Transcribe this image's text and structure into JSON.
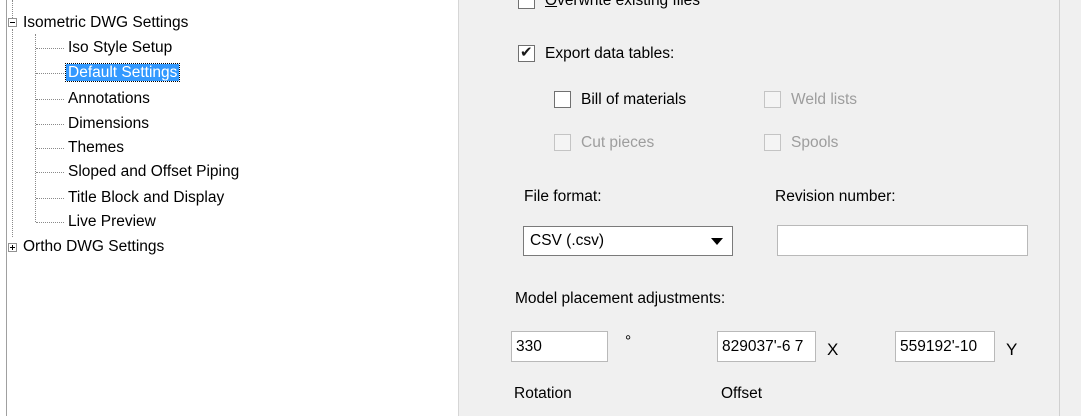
{
  "tree": {
    "items": [
      {
        "label": "Isometric DWG Settings",
        "expander": "minus"
      },
      {
        "label": "Iso Style Setup"
      },
      {
        "label": "Default Settings",
        "selected": true
      },
      {
        "label": "Annotations"
      },
      {
        "label": "Dimensions"
      },
      {
        "label": "Themes"
      },
      {
        "label": "Sloped and Offset Piping"
      },
      {
        "label": "Title Block and Display"
      },
      {
        "label": "Live Preview"
      },
      {
        "label": "Ortho DWG Settings",
        "expander": "plus"
      }
    ]
  },
  "panel": {
    "overwrite_label_underlined": "O",
    "overwrite_label_rest": "verwrite existing files",
    "export_tables": {
      "label": "Export data tables:",
      "checked": true
    },
    "bill_of_materials": {
      "label": "Bill of materials",
      "checked": false,
      "enabled": true
    },
    "weld_lists": {
      "label": "Weld lists",
      "checked": false,
      "enabled": false
    },
    "cut_pieces": {
      "label": "Cut pieces",
      "checked": false,
      "enabled": false
    },
    "spools": {
      "label": "Spools",
      "checked": false,
      "enabled": false
    },
    "file_format_label": "File format:",
    "file_format_value": "CSV (.csv)",
    "revision_label": "Revision number:",
    "revision_value": "",
    "model_placement_label": "Model placement adjustments:",
    "rotation_value": "330",
    "degree_symbol": "°",
    "offset_x_value": "829037'-6 7",
    "x_label": "X",
    "offset_y_value": "559192'-10",
    "y_label": "Y",
    "rotation_label": "Rotation",
    "offset_label": "Offset"
  },
  "colors": {
    "selection": "#3399ff",
    "panel_bg": "#f0f0f0",
    "disabled_text": "#9d9d9d"
  },
  "icons": {
    "check": "check-icon",
    "collapse": "minus-icon",
    "expand": "plus-icon",
    "dropdown": "chevron-down-icon"
  }
}
